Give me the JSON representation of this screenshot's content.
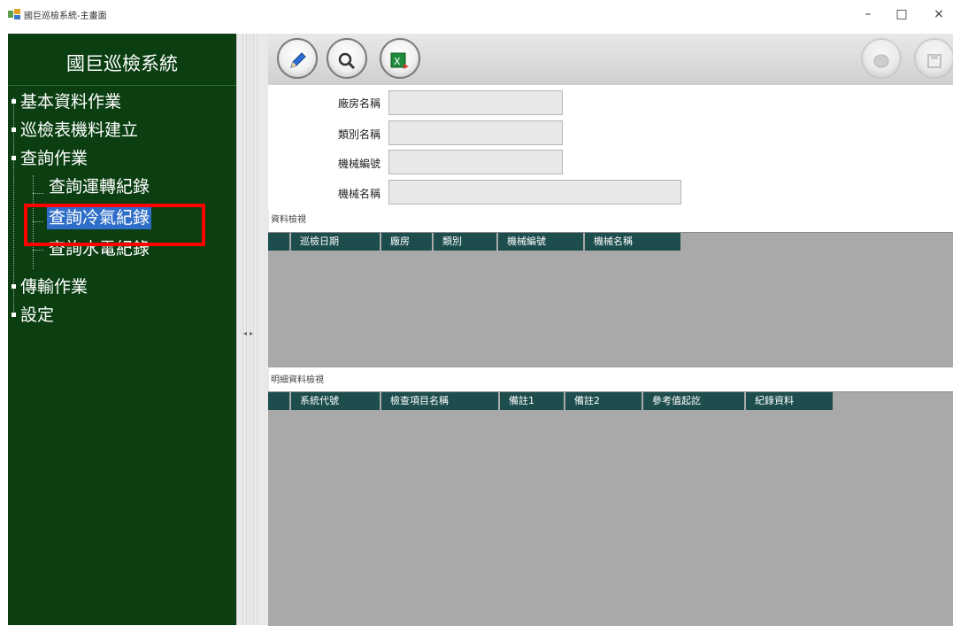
{
  "window": {
    "title": "國巨巡檢系統-主畫面",
    "minimize": "–",
    "maximize": "□",
    "close": "×"
  },
  "sidebar": {
    "title": "國巨巡檢系統",
    "items": [
      {
        "label": "基本資料作業"
      },
      {
        "label": "巡檢表機料建立"
      },
      {
        "label": "查詢作業",
        "children": [
          {
            "label": "查詢運轉紀錄"
          },
          {
            "label": "查詢冷氣紀錄",
            "selected": true
          },
          {
            "label": "查詢水電紀錄"
          }
        ]
      },
      {
        "label": "傳輸作業"
      },
      {
        "label": "設定"
      }
    ]
  },
  "toolbar": {
    "buttons": [
      {
        "name": "edit",
        "icon": "pencil-icon",
        "enabled": true
      },
      {
        "name": "search",
        "icon": "magnifier-icon",
        "enabled": true
      },
      {
        "name": "excel",
        "icon": "excel-export-icon",
        "enabled": true
      },
      {
        "name": "disabled-1",
        "icon": "disabled-action-icon",
        "enabled": false
      },
      {
        "name": "save",
        "icon": "save-icon",
        "enabled": false
      }
    ]
  },
  "form": {
    "fields": [
      {
        "label": "廠房名稱",
        "value": ""
      },
      {
        "label": "類別名稱",
        "value": ""
      },
      {
        "label": "機械編號",
        "value": ""
      },
      {
        "label": "機械名稱",
        "value": ""
      }
    ]
  },
  "grid1": {
    "title": "資料檢視",
    "columns": [
      "巡檢日期",
      "廠房",
      "類別",
      "機械編號",
      "機械名稱"
    ]
  },
  "grid2": {
    "title": "明細資料檢視",
    "columns": [
      "系統代號",
      "檢查項目名稱",
      "備註1",
      "備註2",
      "參考值起訖",
      "紀錄資料"
    ]
  },
  "colors": {
    "sidebar_bg": "#0b3f12",
    "selection": "#2f6ec8",
    "highlight": "#ff0000",
    "grid_header": "#1d4d4d",
    "grid_bg": "#a9a9a9"
  }
}
